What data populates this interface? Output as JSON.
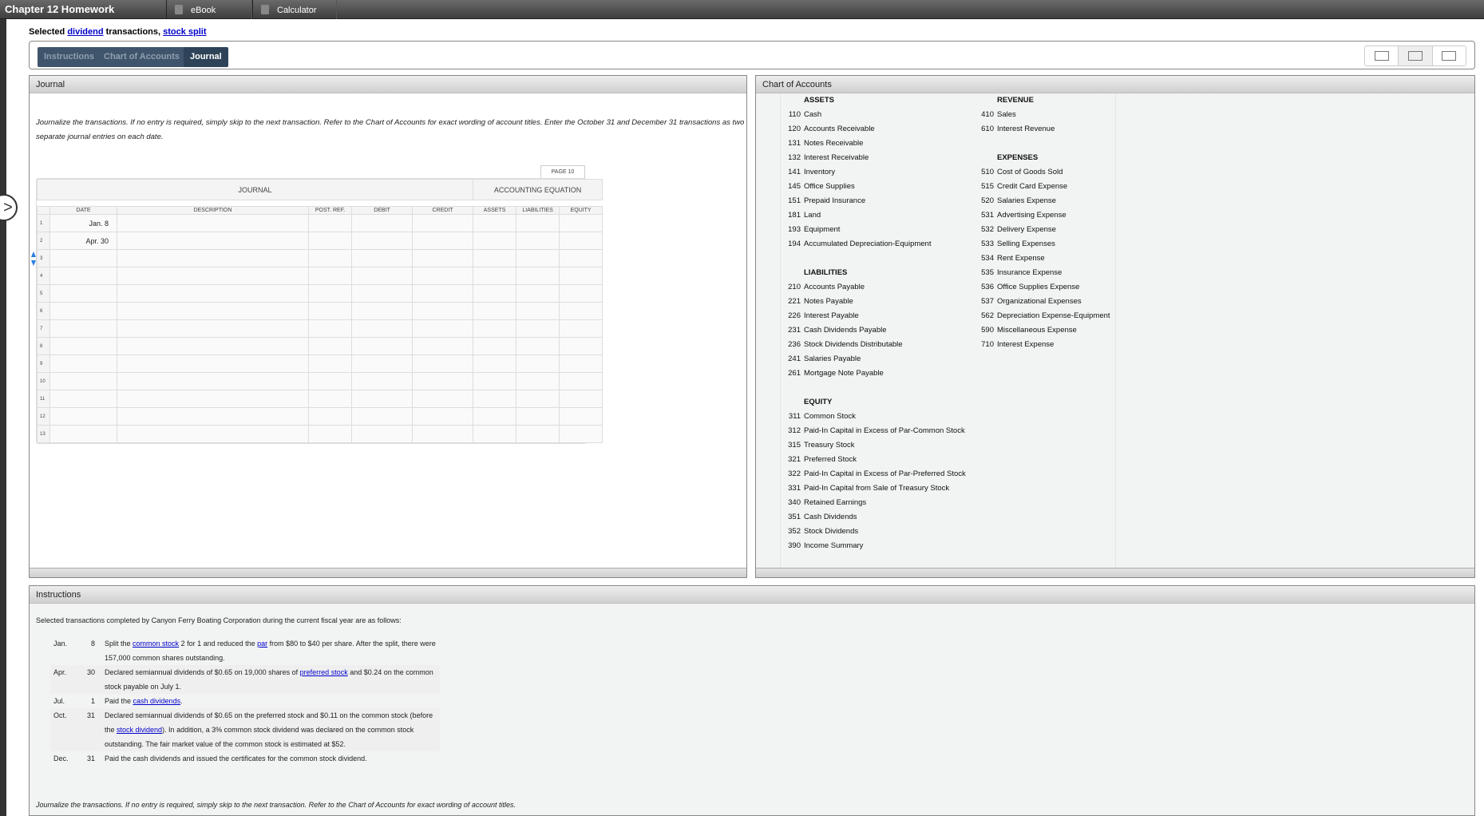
{
  "topbar": {
    "title": "Chapter 12 Homework",
    "buttons": [
      {
        "label": "eBook",
        "icon": "book-icon"
      },
      {
        "label": "Calculator",
        "icon": "calculator-icon"
      }
    ]
  },
  "subtitle": {
    "prefix": "Selected ",
    "link1": "dividend",
    "middle": " transactions, ",
    "link2": "stock split"
  },
  "tabs": [
    {
      "label": "Instructions",
      "active": false
    },
    {
      "label": "Chart of Accounts",
      "active": false
    },
    {
      "label": "Journal",
      "active": true
    }
  ],
  "view_modes": [
    "window-view-icon",
    "split-view-icon",
    "stacked-view-icon"
  ],
  "journal": {
    "panel_title": "Journal",
    "intro": "Journalize the transactions. If no entry is required, simply skip to the next transaction. Refer to the Chart of Accounts for exact wording of account titles. Enter the October 31 and December 31 transactions as two separate journal entries on each date.",
    "page_label": "PAGE 10",
    "group_headers": [
      "JOURNAL",
      "ACCOUNTING EQUATION"
    ],
    "columns": [
      "DATE",
      "DESCRIPTION",
      "POST. REF.",
      "DEBIT",
      "CREDIT",
      "ASSETS",
      "LIABILITIES",
      "EQUITY"
    ],
    "rows": [
      {
        "num": "1",
        "date": "Jan. 8"
      },
      {
        "num": "2",
        "date": "Apr. 30"
      },
      {
        "num": "3",
        "date": ""
      },
      {
        "num": "4",
        "date": ""
      },
      {
        "num": "5",
        "date": ""
      },
      {
        "num": "6",
        "date": ""
      },
      {
        "num": "7",
        "date": ""
      },
      {
        "num": "8",
        "date": ""
      },
      {
        "num": "9",
        "date": ""
      },
      {
        "num": "10",
        "date": ""
      },
      {
        "num": "11",
        "date": ""
      },
      {
        "num": "12",
        "date": ""
      },
      {
        "num": "13",
        "date": ""
      }
    ]
  },
  "chart_of_accounts": {
    "panel_title": "Chart of Accounts",
    "left": [
      {
        "section": "ASSETS",
        "items": [
          {
            "code": "110",
            "name": "Cash"
          },
          {
            "code": "120",
            "name": "Accounts Receivable"
          },
          {
            "code": "131",
            "name": "Notes Receivable"
          },
          {
            "code": "132",
            "name": "Interest Receivable"
          },
          {
            "code": "141",
            "name": "Inventory"
          },
          {
            "code": "145",
            "name": "Office Supplies"
          },
          {
            "code": "151",
            "name": "Prepaid Insurance"
          },
          {
            "code": "181",
            "name": "Land"
          },
          {
            "code": "193",
            "name": "Equipment"
          },
          {
            "code": "194",
            "name": "Accumulated Depreciation-Equipment"
          }
        ]
      },
      {
        "section": "LIABILITIES",
        "items": [
          {
            "code": "210",
            "name": "Accounts Payable"
          },
          {
            "code": "221",
            "name": "Notes Payable"
          },
          {
            "code": "226",
            "name": "Interest Payable"
          },
          {
            "code": "231",
            "name": "Cash Dividends Payable"
          },
          {
            "code": "236",
            "name": "Stock Dividends Distributable"
          },
          {
            "code": "241",
            "name": "Salaries Payable"
          },
          {
            "code": "261",
            "name": "Mortgage Note Payable"
          }
        ]
      },
      {
        "section": "EQUITY",
        "items": [
          {
            "code": "311",
            "name": "Common Stock"
          },
          {
            "code": "312",
            "name": "Paid-In Capital in Excess of Par-Common Stock"
          },
          {
            "code": "315",
            "name": "Treasury Stock"
          },
          {
            "code": "321",
            "name": "Preferred Stock"
          },
          {
            "code": "322",
            "name": "Paid-In Capital in Excess of Par-Preferred Stock"
          },
          {
            "code": "331",
            "name": "Paid-In Capital from Sale of Treasury Stock"
          },
          {
            "code": "340",
            "name": "Retained Earnings"
          },
          {
            "code": "351",
            "name": "Cash Dividends"
          },
          {
            "code": "352",
            "name": "Stock Dividends"
          },
          {
            "code": "390",
            "name": "Income Summary"
          }
        ]
      }
    ],
    "right": [
      {
        "section": "REVENUE",
        "items": [
          {
            "code": "410",
            "name": "Sales"
          },
          {
            "code": "610",
            "name": "Interest Revenue"
          }
        ]
      },
      {
        "section": "EXPENSES",
        "items": [
          {
            "code": "510",
            "name": "Cost of Goods Sold"
          },
          {
            "code": "515",
            "name": "Credit Card Expense"
          },
          {
            "code": "520",
            "name": "Salaries Expense"
          },
          {
            "code": "531",
            "name": "Advertising Expense"
          },
          {
            "code": "532",
            "name": "Delivery Expense"
          },
          {
            "code": "533",
            "name": "Selling Expenses"
          },
          {
            "code": "534",
            "name": "Rent Expense"
          },
          {
            "code": "535",
            "name": "Insurance Expense"
          },
          {
            "code": "536",
            "name": "Office Supplies Expense"
          },
          {
            "code": "537",
            "name": "Organizational Expenses"
          },
          {
            "code": "562",
            "name": "Depreciation Expense-Equipment"
          },
          {
            "code": "590",
            "name": "Miscellaneous Expense"
          },
          {
            "code": "710",
            "name": "Interest Expense"
          }
        ]
      }
    ]
  },
  "instructions": {
    "panel_title": "Instructions",
    "lead": "Selected transactions completed by Canyon Ferry Boating Corporation during the current fiscal year are as follows:",
    "transactions": [
      {
        "month": "Jan.",
        "day": "8",
        "parts": [
          {
            "text": "Split the "
          },
          {
            "link": "common stock"
          },
          {
            "text": " 2 for 1 and reduced the "
          },
          {
            "link": "par"
          },
          {
            "text": " from $80 to $40 per share. After the split, there were 157,000 common shares outstanding."
          }
        ]
      },
      {
        "month": "Apr.",
        "day": "30",
        "parts": [
          {
            "text": "Declared semiannual dividends of $0.65 on 19,000 shares of "
          },
          {
            "link": "preferred stock"
          },
          {
            "text": " and $0.24 on the common stock payable on July 1."
          }
        ]
      },
      {
        "month": "Jul.",
        "day": "1",
        "parts": [
          {
            "text": "Paid the "
          },
          {
            "link": "cash dividends"
          },
          {
            "text": "."
          }
        ]
      },
      {
        "month": "Oct.",
        "day": "31",
        "parts": [
          {
            "text": "Declared semiannual dividends of $0.65 on the preferred stock and $0.11 on the common stock (before the "
          },
          {
            "link": "stock dividend"
          },
          {
            "text": "). In addition, a 3% common stock dividend was declared on the common stock outstanding. The fair market value of the common stock is estimated at $52."
          }
        ]
      },
      {
        "month": "Dec.",
        "day": "31",
        "parts": [
          {
            "text": "Paid the cash dividends and issued the certificates for the common stock dividend."
          }
        ]
      }
    ],
    "footer": "Journalize the transactions. If no entry is required, simply skip to the next transaction. Refer to the Chart of Accounts for exact wording of account titles."
  }
}
